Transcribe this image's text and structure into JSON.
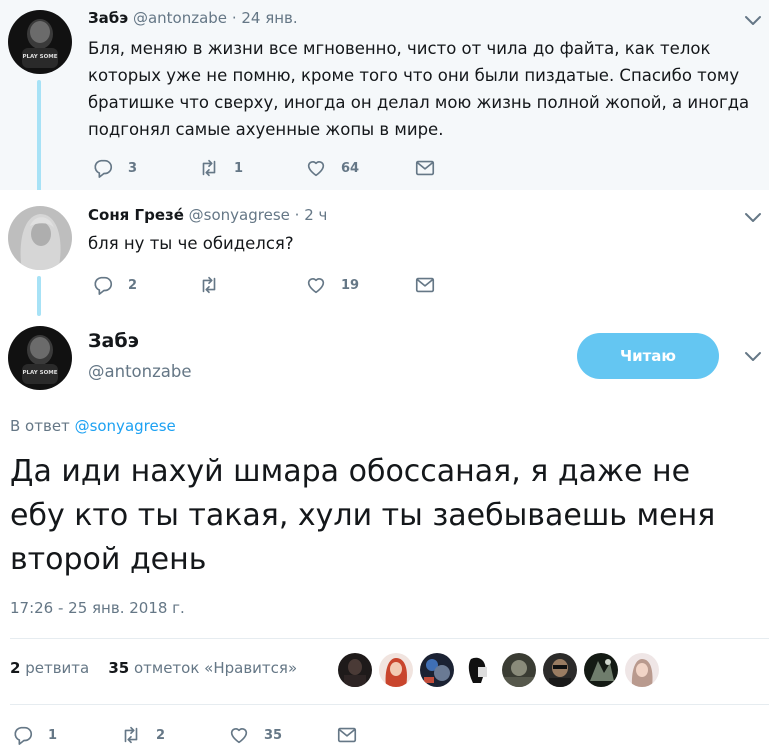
{
  "parent_tweet": {
    "name": "Забэ",
    "handle": "@antonzabe",
    "separator": "·",
    "time": "24 янв.",
    "text": "Бля, меняю в жизни все мгновенно, чисто от чила до файта, как телок которых уже не помню, кроме того что они были пиздатые. Спасибо тому братишке что сверху, иногда он делал мою жизнь полной жопой, а иногда подгонял самые ахуенные жопы в мире.",
    "text_lines": [
      "Бля, меняю в жизни все мгновенно, чисто от чила до файта, как телок",
      "которых уже не помню, кроме того что они были пиздатые. Спасибо тому",
      "братишке что сверху, иногда он делал мою жизнь полной жопой, а иногда",
      "подгонял самые ахуенные жопы в мире."
    ],
    "reply_count": "3",
    "retweet_count": "1",
    "like_count": "64",
    "avatar_text": "PLAY SOME"
  },
  "second_tweet": {
    "name": "Соня Грезé",
    "handle": "@sonyagrese",
    "separator": "·",
    "time": "2 ч",
    "text": "бля ну ты че обиделся?",
    "reply_count": "2",
    "retweet_count": "",
    "like_count": "19"
  },
  "focus_tweet": {
    "name": "Забэ",
    "handle": "@antonzabe",
    "follow_label": "Читаю",
    "reply_prefix": "В ответ",
    "reply_to": "@sonyagrese",
    "text_lines": [
      "Да иди нахуй шмара обоссаная, я даже не",
      "ебу кто ты такая, хули ты заебываешь меня",
      "второй день"
    ],
    "timestamp": "17:26 - 25 янв. 2018 г.",
    "retweets_num": "2",
    "retweets_label": "ретвита",
    "likes_num": "35",
    "likes_label": "отметок «Нравится»",
    "reply_count": "1",
    "retweet_count": "2",
    "like_count": "35",
    "avatar_text": "PLAY SOME"
  },
  "colors": {
    "accent": "#1da1f2",
    "follow_button": "#64c6f2",
    "thread_line": "#a7e2f6",
    "muted": "#657786",
    "highlight_bg": "#f5f8fa"
  },
  "icons": [
    "reply-icon",
    "retweet-icon",
    "like-icon",
    "message-icon",
    "chevron-down-icon"
  ]
}
